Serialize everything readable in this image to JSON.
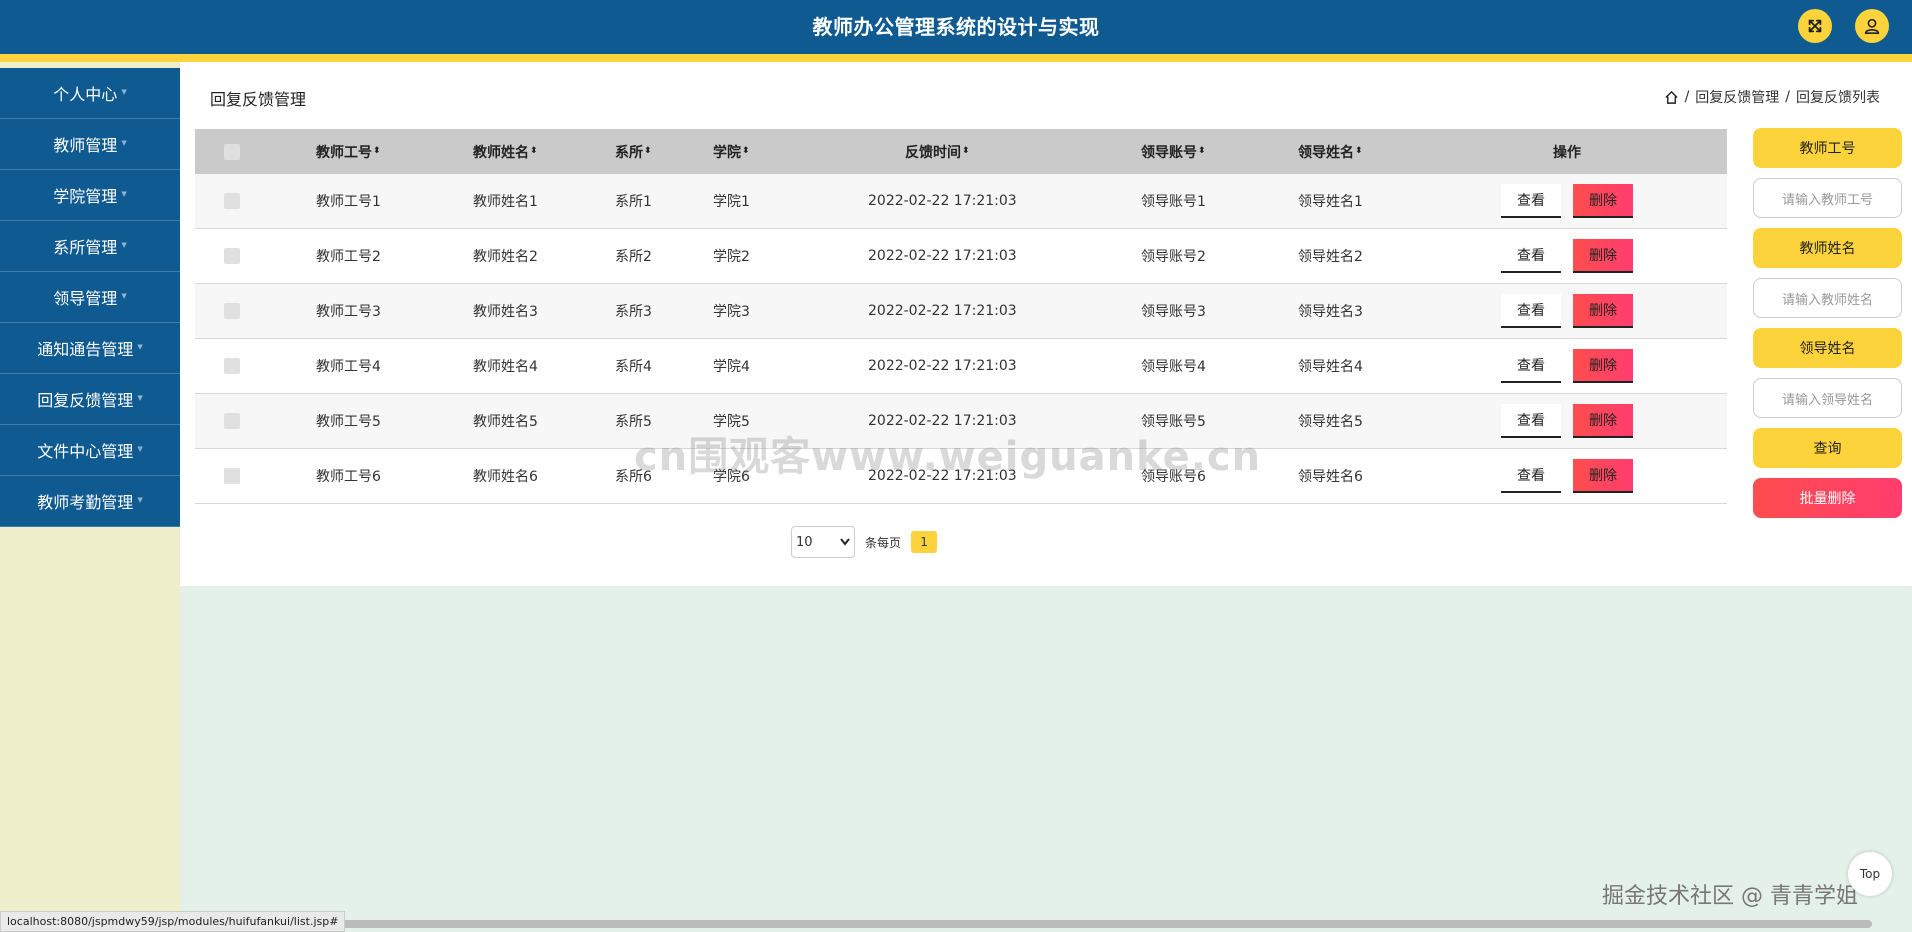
{
  "header": {
    "title": "教师办公管理系统的设计与实现"
  },
  "sidebar": {
    "items": [
      {
        "label": "个人中心"
      },
      {
        "label": "教师管理"
      },
      {
        "label": "学院管理"
      },
      {
        "label": "系所管理"
      },
      {
        "label": "领导管理"
      },
      {
        "label": "通知通告管理"
      },
      {
        "label": "回复反馈管理"
      },
      {
        "label": "文件中心管理"
      },
      {
        "label": "教师考勤管理"
      }
    ],
    "caret": "▼"
  },
  "page": {
    "title": "回复反馈管理",
    "breadcrumb": [
      "回复反馈管理",
      "回复反馈列表"
    ],
    "breadcrumb_sep": "/"
  },
  "table": {
    "columns": [
      "教师工号",
      "教师姓名",
      "系所",
      "学院",
      "反馈时间",
      "领导账号",
      "领导姓名",
      "操作"
    ],
    "sort_icon": "⬍",
    "view_label": "查看",
    "delete_label": "删除",
    "rows": [
      [
        "教师工号1",
        "教师姓名1",
        "系所1",
        "学院1",
        "2022-02-22 17:21:03",
        "领导账号1",
        "领导姓名1"
      ],
      [
        "教师工号2",
        "教师姓名2",
        "系所2",
        "学院2",
        "2022-02-22 17:21:03",
        "领导账号2",
        "领导姓名2"
      ],
      [
        "教师工号3",
        "教师姓名3",
        "系所3",
        "学院3",
        "2022-02-22 17:21:03",
        "领导账号3",
        "领导姓名3"
      ],
      [
        "教师工号4",
        "教师姓名4",
        "系所4",
        "学院4",
        "2022-02-22 17:21:03",
        "领导账号4",
        "领导姓名4"
      ],
      [
        "教师工号5",
        "教师姓名5",
        "系所5",
        "学院5",
        "2022-02-22 17:21:03",
        "领导账号5",
        "领导姓名5"
      ],
      [
        "教师工号6",
        "教师姓名6",
        "系所6",
        "学院6",
        "2022-02-22 17:21:03",
        "领导账号6",
        "领导姓名6"
      ]
    ]
  },
  "pagination": {
    "page_size": "10",
    "page_size_label": "条每页",
    "current_page": "1"
  },
  "search": {
    "teacher_id_label": "教师工号",
    "teacher_id_placeholder": "请输入教师工号",
    "teacher_name_label": "教师姓名",
    "teacher_name_placeholder": "请输入教师姓名",
    "leader_name_label": "领导姓名",
    "leader_name_placeholder": "请输入领导姓名",
    "query_label": "查询",
    "batch_delete_label": "批量删除"
  },
  "watermark": "cn围观客www.weiguanke.cn",
  "corner_watermark": "掘金技术社区 @ 青青学姐",
  "top_button": "Top",
  "status_url": "localhost:8080/jspmdwy59/jsp/modules/huifufankui/list.jsp#",
  "colors": {
    "primary": "#0f5a91",
    "accent": "#fdd33b",
    "danger": "#ff4d4f"
  }
}
